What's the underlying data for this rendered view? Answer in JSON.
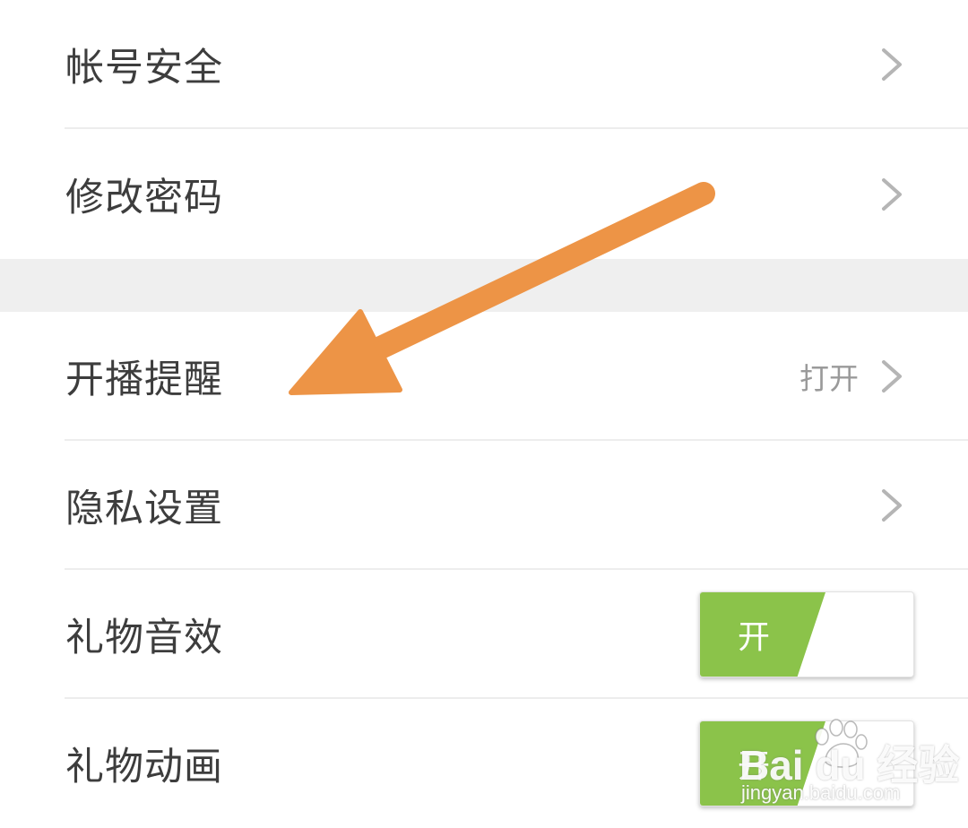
{
  "settings": {
    "account_security": {
      "label": "帐号安全"
    },
    "change_password": {
      "label": "修改密码"
    },
    "live_reminder": {
      "label": "开播提醒",
      "value": "打开"
    },
    "privacy_settings": {
      "label": "隐私设置"
    },
    "gift_sound": {
      "label": "礼物音效",
      "toggle_label": "开",
      "enabled": true
    },
    "gift_animation": {
      "label": "礼物动画",
      "toggle_label": "开",
      "enabled": true
    }
  },
  "annotation": {
    "arrow_color": "#ED9446"
  },
  "toggle_on_color": "#8BC34A",
  "watermark": {
    "logo": "Bai du 经验",
    "url": "jingyan.baidu.com"
  }
}
